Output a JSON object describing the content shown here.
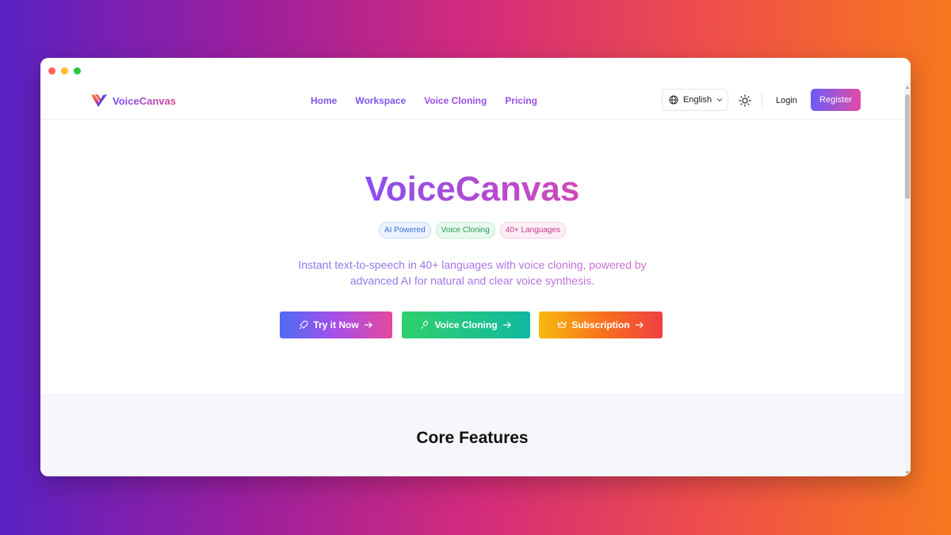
{
  "window": {
    "controls": [
      "close",
      "minimize",
      "maximize"
    ]
  },
  "navbar": {
    "brand": "VoiceCanvas",
    "links": [
      "Home",
      "Workspace",
      "Voice Cloning",
      "Pricing"
    ],
    "language": "English",
    "login": "Login",
    "register": "Register"
  },
  "hero": {
    "title": "VoiceCanvas",
    "badges": [
      "AI Powered",
      "Voice Cloning",
      "40+ Languages"
    ],
    "subtitle": "Instant text-to-speech in 40+ languages with voice cloning, powered by advanced AI for natural and clear voice synthesis.",
    "buttons": {
      "try": "Try it Now",
      "clone": "Voice Cloning",
      "subscription": "Subscription"
    }
  },
  "features": {
    "title": "Core Features"
  },
  "colors": {
    "accent": "#8155e8",
    "brand_gradient_start": "#7c4dff",
    "brand_gradient_end": "#d0478f"
  }
}
